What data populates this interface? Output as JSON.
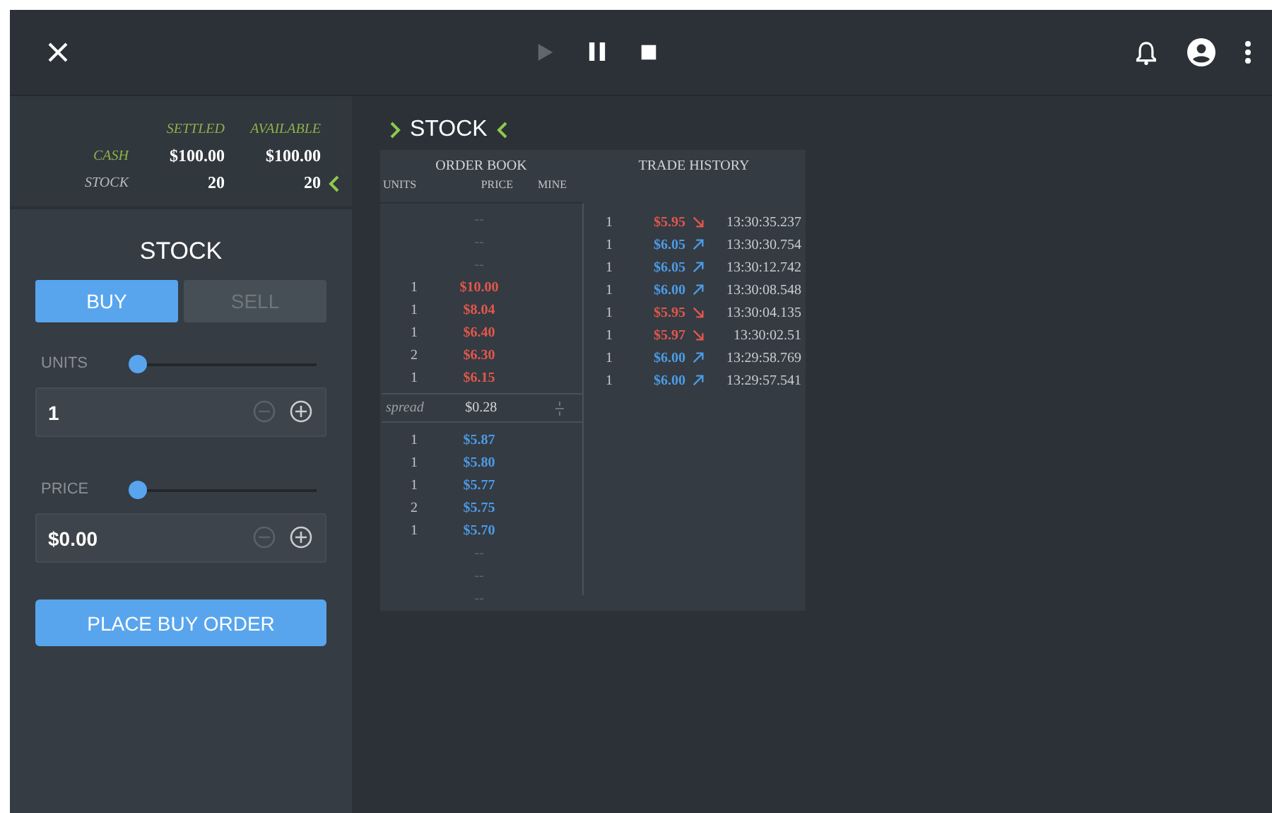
{
  "playback": [
    {
      "kind": "play",
      "disabled": true
    },
    {
      "kind": "pause",
      "disabled": false
    },
    {
      "kind": "stop",
      "disabled": false
    }
  ],
  "balances": {
    "columns": [
      "SETTLED",
      "AVAILABLE"
    ],
    "rows": [
      {
        "label": "CASH",
        "color": "#8fb04a",
        "settled": "$100.00",
        "available": "$100.00"
      },
      {
        "label": "STOCK",
        "color": "#b8bcc0",
        "settled": "20",
        "available": "20"
      }
    ]
  },
  "order_form": {
    "title": "STOCK",
    "sides": [
      {
        "label": "BUY",
        "selected": true
      },
      {
        "label": "SELL",
        "selected": false
      }
    ],
    "fields": [
      {
        "label": "UNITS",
        "level": 0,
        "value": "1"
      },
      {
        "label": "PRICE",
        "level": 0,
        "value": "$0.00"
      }
    ],
    "submit": "PLACE BUY ORDER"
  },
  "market_title": "STOCK",
  "order_book": {
    "title": "ORDER BOOK",
    "columns": [
      "UNITS",
      "PRICE",
      "MINE"
    ],
    "asks": [
      {
        "price": "--"
      },
      {
        "price": "--"
      },
      {
        "price": "--"
      },
      {
        "units": "1",
        "price": "$10.00"
      },
      {
        "units": "1",
        "price": "$8.04"
      },
      {
        "units": "1",
        "price": "$6.40"
      },
      {
        "units": "2",
        "price": "$6.30"
      },
      {
        "units": "1",
        "price": "$6.15"
      }
    ],
    "spread": {
      "label": "spread",
      "value": "$0.28"
    },
    "bids": [
      {
        "units": "1",
        "price": "$5.87"
      },
      {
        "units": "1",
        "price": "$5.80"
      },
      {
        "units": "1",
        "price": "$5.77"
      },
      {
        "units": "2",
        "price": "$5.75"
      },
      {
        "units": "1",
        "price": "$5.70"
      },
      {
        "price": "--"
      },
      {
        "price": "--"
      },
      {
        "price": "--"
      }
    ]
  },
  "trade_history": {
    "title": "TRADE HISTORY",
    "trades": [
      {
        "units": "1",
        "price": "$5.95",
        "kind": "down",
        "time": "13:30:35.237"
      },
      {
        "units": "1",
        "price": "$6.05",
        "kind": "up",
        "time": "13:30:30.754"
      },
      {
        "units": "1",
        "price": "$6.05",
        "kind": "up",
        "time": "13:30:12.742"
      },
      {
        "units": "1",
        "price": "$6.00",
        "kind": "up",
        "time": "13:30:08.548"
      },
      {
        "units": "1",
        "price": "$5.95",
        "kind": "down",
        "time": "13:30:04.135"
      },
      {
        "units": "1",
        "price": "$5.97",
        "kind": "down",
        "time": "13:30:02.51"
      },
      {
        "units": "1",
        "price": "$6.00",
        "kind": "up",
        "time": "13:29:58.769"
      },
      {
        "units": "1",
        "price": "$6.00",
        "kind": "up",
        "time": "13:29:57.541"
      }
    ]
  }
}
